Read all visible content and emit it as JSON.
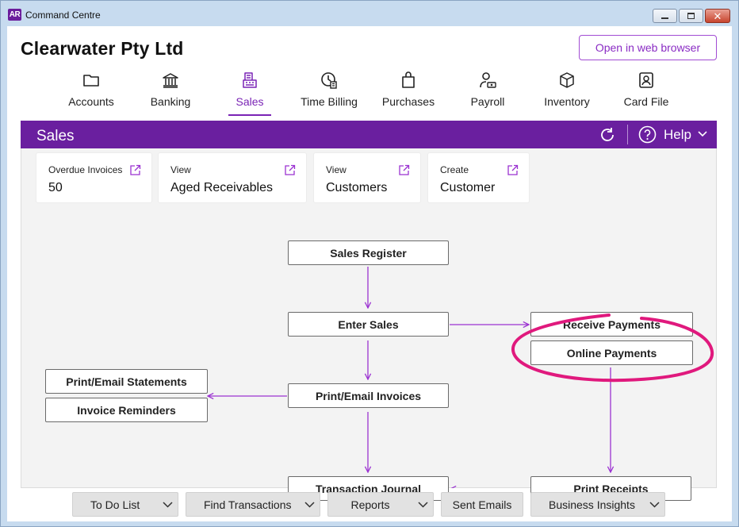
{
  "window": {
    "app_badge": "AR",
    "title": "Command Centre"
  },
  "header": {
    "company_name": "Clearwater Pty Ltd",
    "web_button": "Open in web browser"
  },
  "nav": {
    "items": [
      {
        "label": "Accounts",
        "icon": "folder-icon"
      },
      {
        "label": "Banking",
        "icon": "bank-icon"
      },
      {
        "label": "Sales",
        "icon": "sales-register-icon",
        "active": true
      },
      {
        "label": "Time Billing",
        "icon": "clock-icon"
      },
      {
        "label": "Purchases",
        "icon": "shopping-bag-icon"
      },
      {
        "label": "Payroll",
        "icon": "person-money-icon"
      },
      {
        "label": "Inventory",
        "icon": "box-icon"
      },
      {
        "label": "Card File",
        "icon": "contact-card-icon"
      }
    ]
  },
  "panel": {
    "title": "Sales",
    "help_label": "Help",
    "accent_color": "#6a1f9f"
  },
  "cards": [
    {
      "label": "Overdue Invoices",
      "value": "50"
    },
    {
      "label": "View",
      "value": "Aged Receivables"
    },
    {
      "label": "View",
      "value": "Customers"
    },
    {
      "label": "Create",
      "value": "Customer"
    }
  ],
  "flow": {
    "sales_register": "Sales Register",
    "enter_sales": "Enter Sales",
    "receive_payments": "Receive Payments",
    "online_payments": "Online Payments",
    "print_email_statements": "Print/Email Statements",
    "invoice_reminders": "Invoice Reminders",
    "print_email_invoices": "Print/Email Invoices",
    "transaction_journal": "Transaction Journal",
    "print_receipts": "Print Receipts",
    "arrow_color": "#9b32d1",
    "highlight_color": "#e0197d"
  },
  "bottom": {
    "to_do_list": "To Do List",
    "find_transactions": "Find Transactions",
    "reports": "Reports",
    "sent_emails": "Sent Emails",
    "business_insights": "Business Insights"
  }
}
